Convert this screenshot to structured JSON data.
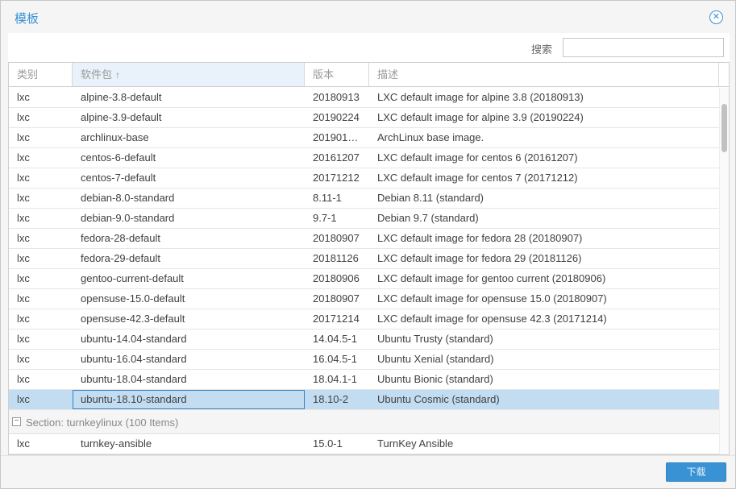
{
  "window": {
    "title": "模板",
    "close_icon": "close-icon"
  },
  "toolbar": {
    "search_label": "搜索",
    "search_value": "",
    "search_placeholder": ""
  },
  "grid": {
    "columns": [
      {
        "label": "类别"
      },
      {
        "label": "软件包",
        "sort": "↑"
      },
      {
        "label": "版本"
      },
      {
        "label": "描述"
      }
    ],
    "rows": [
      {
        "type": "lxc",
        "package": "alpine-3.8-default",
        "version": "20180913",
        "description": "LXC default image for alpine 3.8 (20180913)"
      },
      {
        "type": "lxc",
        "package": "alpine-3.9-default",
        "version": "20190224",
        "description": "LXC default image for alpine 3.9 (20190224)"
      },
      {
        "type": "lxc",
        "package": "archlinux-base",
        "version": "201901…",
        "description": "ArchLinux base image."
      },
      {
        "type": "lxc",
        "package": "centos-6-default",
        "version": "20161207",
        "description": "LXC default image for centos 6 (20161207)"
      },
      {
        "type": "lxc",
        "package": "centos-7-default",
        "version": "20171212",
        "description": "LXC default image for centos 7 (20171212)"
      },
      {
        "type": "lxc",
        "package": "debian-8.0-standard",
        "version": "8.11-1",
        "description": "Debian 8.11 (standard)"
      },
      {
        "type": "lxc",
        "package": "debian-9.0-standard",
        "version": "9.7-1",
        "description": "Debian 9.7 (standard)"
      },
      {
        "type": "lxc",
        "package": "fedora-28-default",
        "version": "20180907",
        "description": "LXC default image for fedora 28 (20180907)"
      },
      {
        "type": "lxc",
        "package": "fedora-29-default",
        "version": "20181126",
        "description": "LXC default image for fedora 29 (20181126)"
      },
      {
        "type": "lxc",
        "package": "gentoo-current-default",
        "version": "20180906",
        "description": "LXC default image for gentoo current (20180906)"
      },
      {
        "type": "lxc",
        "package": "opensuse-15.0-default",
        "version": "20180907",
        "description": "LXC default image for opensuse 15.0 (20180907)"
      },
      {
        "type": "lxc",
        "package": "opensuse-42.3-default",
        "version": "20171214",
        "description": "LXC default image for opensuse 42.3 (20171214)"
      },
      {
        "type": "lxc",
        "package": "ubuntu-14.04-standard",
        "version": "14.04.5-1",
        "description": "Ubuntu Trusty (standard)"
      },
      {
        "type": "lxc",
        "package": "ubuntu-16.04-standard",
        "version": "16.04.5-1",
        "description": "Ubuntu Xenial (standard)"
      },
      {
        "type": "lxc",
        "package": "ubuntu-18.04-standard",
        "version": "18.04.1-1",
        "description": "Ubuntu Bionic (standard)"
      },
      {
        "type": "lxc",
        "package": "ubuntu-18.10-standard",
        "version": "18.10-2",
        "description": "Ubuntu Cosmic (standard)",
        "selected": true
      }
    ],
    "group": {
      "toggle": "−",
      "label": "Section: turnkeylinux (100 Items)"
    },
    "group_rows": [
      {
        "type": "lxc",
        "package": "turnkey-ansible",
        "version": "15.0-1",
        "description": "TurnKey Ansible"
      }
    ]
  },
  "footer": {
    "download_label": "下载"
  },
  "colors": {
    "accent": "#3892d4",
    "selected_row": "#c2ddf2"
  }
}
